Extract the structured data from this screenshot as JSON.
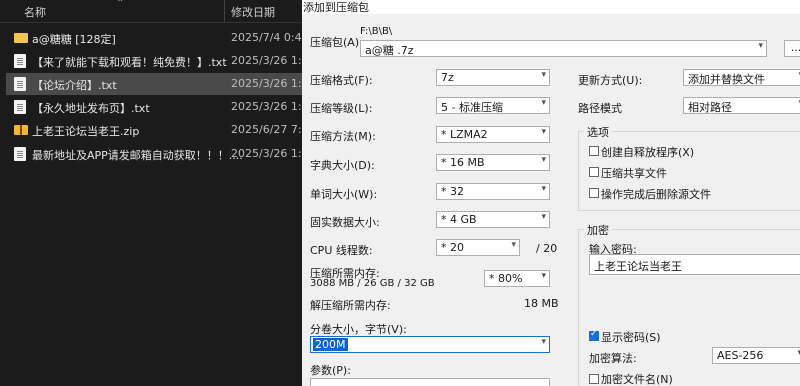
{
  "explorer": {
    "col_name": "名称",
    "col_date": "修改日期",
    "files": [
      {
        "name": "a@糖糖 [128定]",
        "date": "2025/7/4 0:42",
        "type": "folder"
      },
      {
        "name": "【来了就能下载和观看！纯免费！】.txt",
        "date": "2025/3/26 1:07",
        "type": "txt"
      },
      {
        "name": "【论坛介绍】.txt",
        "date": "2025/3/26 1:08",
        "type": "txt"
      },
      {
        "name": "【永久地址发布页】.txt",
        "date": "2025/3/26 1:08",
        "type": "txt"
      },
      {
        "name": "上老王论坛当老王.zip",
        "date": "2025/6/27 7:37",
        "type": "zip"
      },
      {
        "name": "最新地址及APP请发邮箱自动获取！！！....",
        "date": "2025/3/26 1:08",
        "type": "txt"
      }
    ]
  },
  "dialog": {
    "title": "添加到压缩包",
    "archive_label": "压缩包(A)",
    "archive_path": "F:\\B\\B\\",
    "archive_name": "a@糖 .7z",
    "browse_label": "...",
    "format_label": "压缩格式(F):",
    "format_value": "7z",
    "level_label": "压缩等级(L):",
    "level_value": "5 - 标准压缩",
    "method_label": "压缩方法(M):",
    "method_value": "* LZMA2",
    "dict_label": "字典大小(D):",
    "dict_value": "* 16 MB",
    "word_label": "单词大小(W):",
    "word_value": "* 32",
    "solid_label": "固实数据大小:",
    "solid_value": "* 4 GB",
    "threads_label": "CPU 线程数:",
    "threads_value": "* 20",
    "threads_total": "/ 20",
    "mem_label": "压缩所需内存:",
    "mem_detail": "3088 MB / 26 GB / 32 GB",
    "mem_percent": "* 80%",
    "decomp_label": "解压缩所需内存:",
    "decomp_value": "18 MB",
    "split_label": "分卷大小，字节(V):",
    "split_value": "200M",
    "params_label": "参数(P):",
    "update_label": "更新方式(U):",
    "update_value": "添加并替换文件",
    "path_label": "路径模式",
    "path_value": "相对路径",
    "options_title": "选项",
    "opt_sfx": "创建自释放程序(X)",
    "opt_shared": "压缩共享文件",
    "opt_delete": "操作完成后删除源文件",
    "enc_title": "加密",
    "enc_pwd_label": "输入密码:",
    "enc_pwd_value": "上老王论坛当老王",
    "show_pwd_label": "显示密码(S)",
    "enc_method_label": "加密算法:",
    "enc_method_value": "AES-256",
    "enc_names_label": "加密文件名(N)"
  }
}
